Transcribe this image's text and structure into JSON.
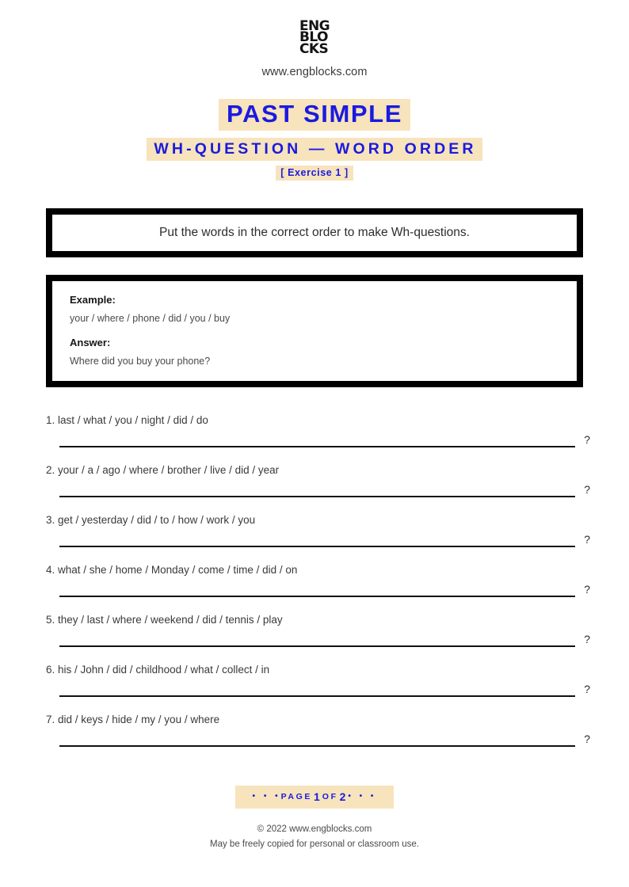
{
  "brand": {
    "logo_lines": [
      "ENG",
      "BLO",
      "CKS"
    ],
    "url": "www.engblocks.com"
  },
  "colors": {
    "accent_blue": "#1a1ae0",
    "highlight_tan": "#f7e3bc",
    "border_black": "#000000",
    "body_text": "#3a3a3a"
  },
  "title": {
    "main": "PAST SIMPLE",
    "sub": "WH-QUESTION — WORD ORDER",
    "exercise": "[ Exercise 1 ]"
  },
  "instruction": {
    "text": "Put the words in the correct order to make Wh-questions."
  },
  "example": {
    "example_label": "Example:",
    "example_text": "your / where / phone / did / you / buy",
    "answer_label": "Answer:",
    "answer_text": "Where did you buy your phone?"
  },
  "items": [
    {
      "number": "1.",
      "text": "1. last / what / you / night / did / do",
      "qmark": "?"
    },
    {
      "number": "2.",
      "text": "2. your / a / ago / where / brother / live / did / year",
      "qmark": "?"
    },
    {
      "number": "3.",
      "text": "3. get / yesterday / did / to / how / work / you",
      "qmark": "?"
    },
    {
      "number": "4.",
      "text": "4. what / she / home / Monday / come / time / did / on",
      "qmark": "?"
    },
    {
      "number": "5.",
      "text": "5. they / last / where / weekend / did / tennis / play",
      "qmark": "?"
    },
    {
      "number": "6.",
      "text": "6. his / John / did / childhood / what / collect / in",
      "qmark": "?"
    },
    {
      "number": "7.",
      "text": "7. did / keys / hide / my / you / where",
      "qmark": "?"
    }
  ],
  "footer": {
    "dots_left": "• • •",
    "page_word": "PAGE",
    "page_current": "1",
    "of_word": "OF",
    "page_total": "2",
    "dots_right": "• • •",
    "copyright": "© 2022 www.engblocks.com",
    "free_use": "May be freely copied for personal or classroom use."
  }
}
